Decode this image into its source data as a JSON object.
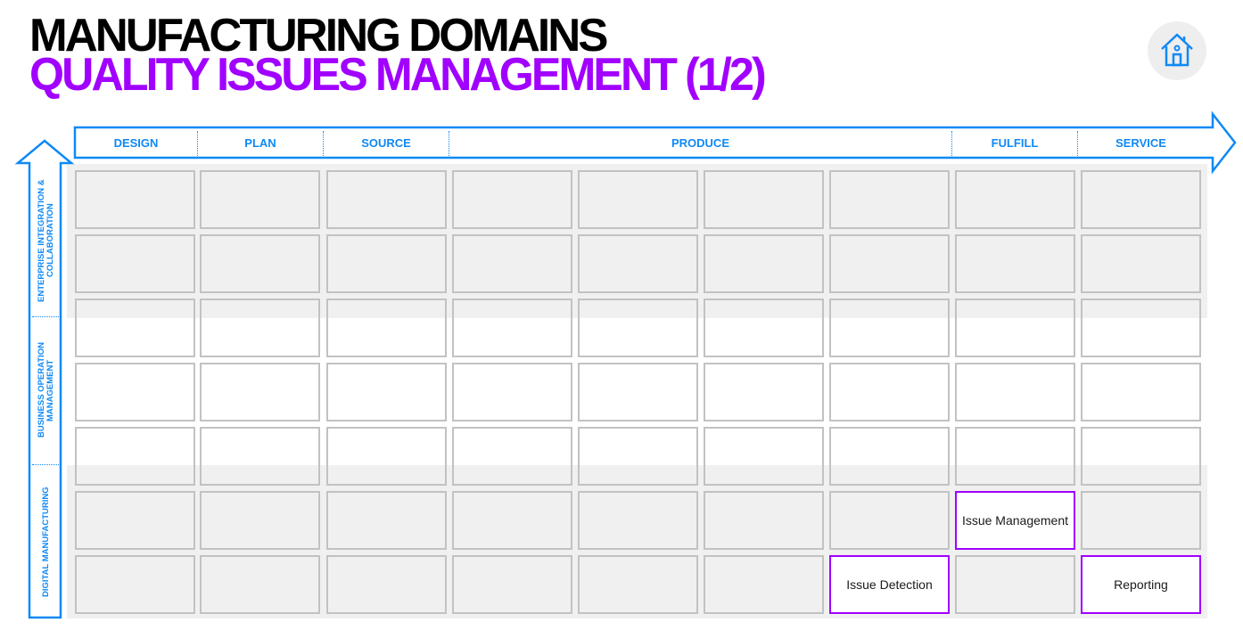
{
  "title": {
    "line1": "MANUFACTURING DOMAINS",
    "line2": "QUALITY ISSUES MANAGEMENT (1/2)"
  },
  "colors": {
    "accent_purple": "#a100ff",
    "accent_blue": "#0f89f5",
    "cell_border": "#c2c2c2",
    "band_gray": "#f0f0f0"
  },
  "home_icon": "home-icon",
  "columns": {
    "design": "DESIGN",
    "plan": "PLAN",
    "source": "SOURCE",
    "produce": "PRODUCE",
    "fulfill": "FULFILL",
    "service": "SERVICE"
  },
  "rows": {
    "enterprise": "ENTERPRISE INTEGRATION & COLLABORATION",
    "business": "BUSINESS OPERATION MANAGEMENT",
    "digital": "DIGITAL MANUFACTURING"
  },
  "highlighted_cells": {
    "issue_management": "Issue Management",
    "issue_detection": "Issue Detection",
    "reporting": "Reporting"
  }
}
